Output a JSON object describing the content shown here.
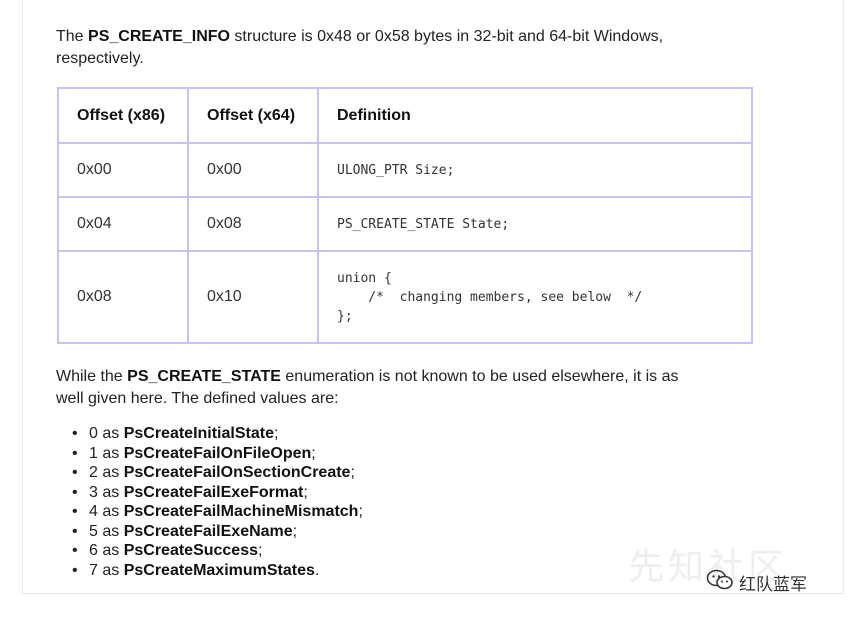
{
  "intro": {
    "prefix": "The ",
    "bold": "PS_CREATE_INFO",
    "suffix_line1": " structure is 0x48 or 0x58 bytes in 32-bit and 64-bit Windows,",
    "line2": "respectively."
  },
  "table": {
    "headers": [
      "Offset (x86)",
      "Offset (x64)",
      "Definition"
    ],
    "rows": [
      {
        "x86": "0x00",
        "x64": "0x00",
        "def": "ULONG_PTR Size;"
      },
      {
        "x86": "0x04",
        "x64": "0x08",
        "def": "PS_CREATE_STATE State;"
      },
      {
        "x86": "0x08",
        "x64": "0x10",
        "def": "union {\n    /*  changing members, see below  */\n};"
      }
    ]
  },
  "enum_intro": {
    "prefix": "While the ",
    "bold": "PS_CREATE_STATE",
    "suffix_line1": " enumeration is not known to be used elsewhere, it is as",
    "line2": "well given here. The defined values are:"
  },
  "values": [
    {
      "num": "0 as ",
      "name": "PsCreateInitialState",
      "end": ";"
    },
    {
      "num": "1 as ",
      "name": "PsCreateFailOnFileOpen",
      "end": ";"
    },
    {
      "num": "2 as ",
      "name": "PsCreateFailOnSectionCreate",
      "end": ";"
    },
    {
      "num": "3 as ",
      "name": "PsCreateFailExeFormat",
      "end": ";"
    },
    {
      "num": "4 as ",
      "name": "PsCreateFailMachineMismatch",
      "end": ";"
    },
    {
      "num": "5 as ",
      "name": "PsCreateFailExeName",
      "end": ";"
    },
    {
      "num": "6 as ",
      "name": "PsCreateSuccess",
      "end": ";"
    },
    {
      "num": "7 as ",
      "name": "PsCreateMaximumStates",
      "end": "."
    }
  ],
  "watermark": "先知社区",
  "brand": {
    "label": "红队蓝军",
    "icon": "wechat-icon"
  }
}
